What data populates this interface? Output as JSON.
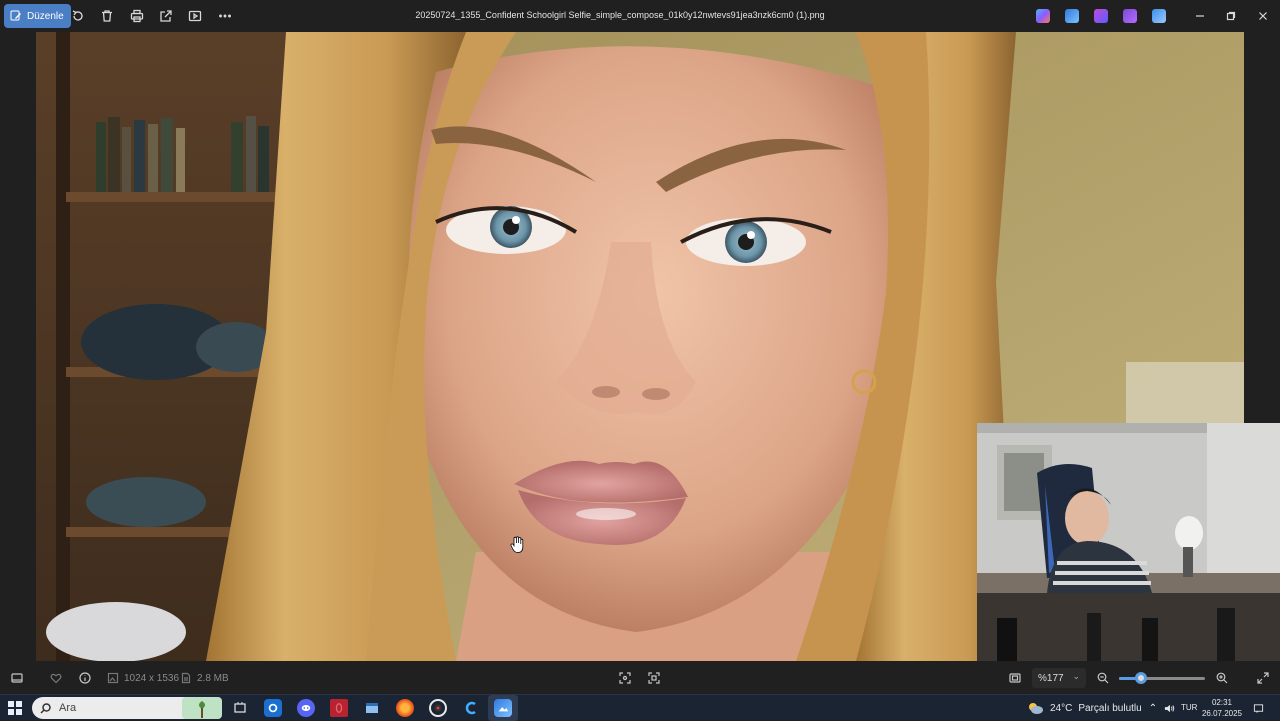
{
  "app": {
    "edit_label": "Düzenle",
    "file_title": "20250724_1355_Confident Schoolgirl Selfie_simple_compose_01k0y12nwtevs91jea3nzk6cm0 (1).png"
  },
  "toolbar_icons": [
    "rotate-icon",
    "delete-icon",
    "print-icon",
    "share-icon",
    "slideshow-icon",
    "more-icon"
  ],
  "status": {
    "dimensions": "1024 x 1536",
    "file_size": "2.8 MB",
    "zoom": "%177",
    "zoom_fraction": 0.26
  },
  "taskbar": {
    "search_placeholder": "Ara",
    "weather_temp": "24°C",
    "weather_text": "Parçalı bulutlu",
    "language": "TUR",
    "time": "02:31",
    "date": "26.07.2025"
  },
  "colors": {
    "accent": "#4a7fc6",
    "slider": "#5b9be0",
    "taskbar": "#1b2433"
  }
}
